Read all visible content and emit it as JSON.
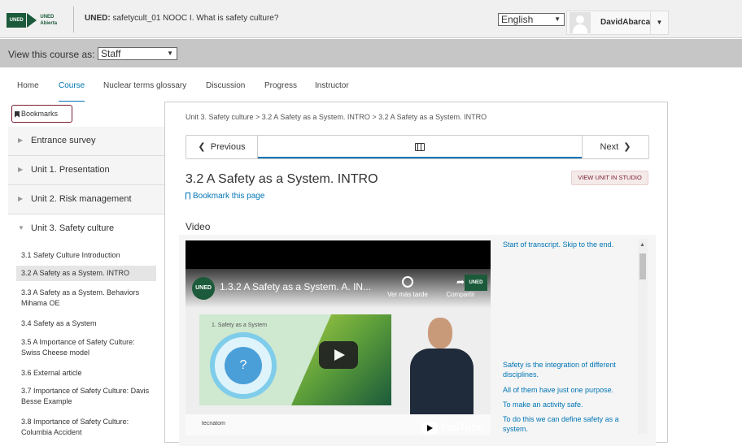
{
  "header": {
    "logo_text": "UNED",
    "logo_sub": "UNED Abierta",
    "course_title_bold": "UNED:",
    "course_title": "safetycult_01 NOOC I. What is safety culture?",
    "language": "English",
    "username": "DavidAbarca"
  },
  "viewbar": {
    "label": "View this course as:",
    "value": "Staff"
  },
  "tabs": [
    "Home",
    "Course",
    "Nuclear terms glossary",
    "Discussion",
    "Progress",
    "Instructor"
  ],
  "sidebar": {
    "bookmarks_label": "Bookmarks",
    "chapters": [
      {
        "label": "Entrance survey"
      },
      {
        "label": "Unit 1. Presentation"
      },
      {
        "label": "Unit 2. Risk management"
      },
      {
        "label": "Unit 3. Safety culture"
      }
    ],
    "sections": [
      "3.1 Safety Culture Introduction",
      "3.2 A Safety as a System. INTRO",
      "3.3 A Safety as a System. Behaviors Mihama OE",
      "3.4 Safety as a System",
      "3.5 A Importance of Safety Culture: Swiss Cheese model",
      "3.6 External article",
      "3.7 Importance of Safety Culture: Davis Besse Example",
      "3.8 Importance of Safety Culture: Columbia Accident"
    ]
  },
  "main": {
    "breadcrumb": "Unit 3. Safety culture > 3.2 A Safety as a System. INTRO > 3.2 A Safety as a System. INTRO",
    "prev_label": "Previous",
    "next_label": "Next",
    "unit_title": "3.2 A Safety as a System. INTRO",
    "studio_label": "VIEW UNIT IN STUDIO",
    "bookmark_link": "Bookmark this page",
    "video_label": "Video"
  },
  "video": {
    "channel_logo": "UNED",
    "title": "1.3.2 A Safety as a System. A. IN...",
    "watch_later": "Ver más tarde",
    "share": "Compartir",
    "slide_title": "1. Safety as a System",
    "slide_mark": "?",
    "footer_logo": "tecnatom",
    "youtube": "YouTube"
  },
  "transcript": {
    "start": "Start of transcript. Skip to the end.",
    "lines": [
      "Safety is the integration of different disciplines.",
      "All of them have just one purpose.",
      "To make an activity safe.",
      "To do this we can define safety as a system."
    ]
  },
  "colors": {
    "accent": "#0075b4",
    "brand": "#1b5a3a",
    "studio": "#7a1d31"
  }
}
